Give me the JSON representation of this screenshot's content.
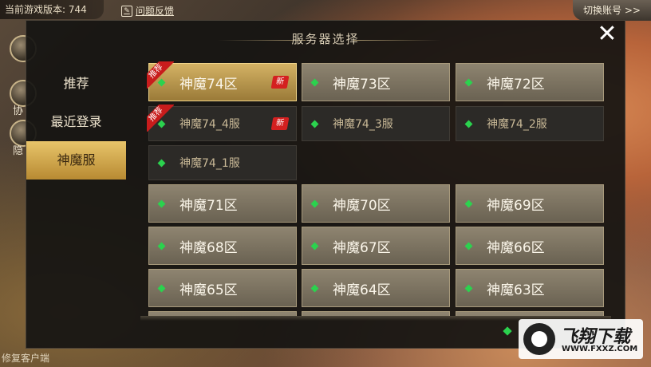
{
  "hud": {
    "version_text": "当前游戏版本: 744",
    "feedback_label": "问题反馈",
    "switch_account_label": "切换账号 >>",
    "side_text_1": "协",
    "side_text_2": "隐",
    "repair_client_label": "修复客户端"
  },
  "dialog": {
    "title": "服务器选择",
    "close_label": "✕"
  },
  "sidebar": {
    "items": [
      {
        "label": "推荐"
      },
      {
        "label": "最近登录"
      },
      {
        "label": "神魔服"
      }
    ]
  },
  "servers": [
    {
      "name": "神魔74区"
    },
    {
      "name": "神魔73区"
    },
    {
      "name": "神魔72区"
    },
    {
      "name": "神魔74_4服"
    },
    {
      "name": "神魔74_3服"
    },
    {
      "name": "神魔74_2服"
    },
    {
      "name": "神魔74_1服"
    },
    {
      "name": "神魔71区"
    },
    {
      "name": "神魔70区"
    },
    {
      "name": "神魔69区"
    },
    {
      "name": "神魔68区"
    },
    {
      "name": "神魔67区"
    },
    {
      "name": "神魔66区"
    },
    {
      "name": "神魔65区"
    },
    {
      "name": "神魔64区"
    },
    {
      "name": "神魔63区"
    }
  ],
  "badges": {
    "recommend": "推荐",
    "new": "新"
  },
  "watermark": {
    "main": "飞翔下载",
    "url": "WWW.FXXZ.COM"
  },
  "colors": {
    "online_dot": "#2bd24e",
    "active_tab": "#e8c46a",
    "badge_red": "#c81c1c"
  }
}
